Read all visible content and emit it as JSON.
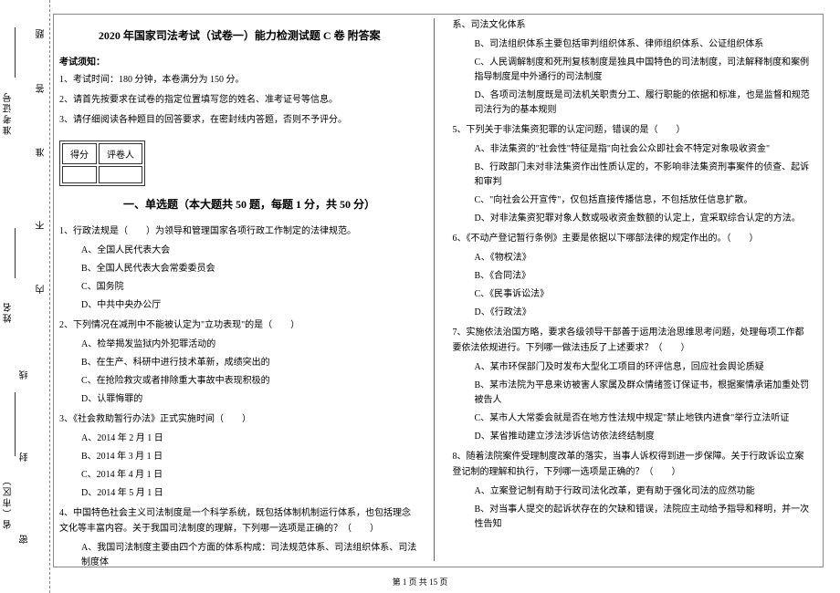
{
  "binding": {
    "province_label": "省（市区）",
    "name_label": "姓名",
    "ticket_label": "准考证号",
    "seal": "密",
    "seal2": "封",
    "seal3": "线",
    "seal4": "内",
    "seal5": "不",
    "seal6": "准",
    "seal7": "答",
    "seal8": "题"
  },
  "title": "2020 年国家司法考试（试卷一）能力检测试题 C 卷 附答案",
  "instructions_header": "考试须知：",
  "instructions": {
    "i1": "1、考试时间：180 分钟，本卷满分为 150 分。",
    "i2": "2、请首先按要求在试卷的指定位置填写您的姓名、准考证号等信息。",
    "i3": "3、请仔细阅读各种题目的回答要求，在密封线内答题，否则不予评分。"
  },
  "score_table": {
    "col1": "得分",
    "col2": "评卷人"
  },
  "section1_title": "一、单选题（本大题共 50 题，每题 1 分，共 50 分）",
  "q1": {
    "stem": "1、行政法规是（　　）为领导和管理国家各项行政工作制定的法律规范。",
    "a": "A、全国人民代表大会",
    "b": "B、全国人民代表大会常委委员会",
    "c": "C、国务院",
    "d": "D、中共中央办公厅"
  },
  "q2": {
    "stem": "2、下列情况在减刑中不能被认定为\"立功表现\"的是（　　）",
    "a": "A、检举揭发监狱内外犯罪活动的",
    "b": "B、在生产、科研中进行技术革新，成绩突出的",
    "c": "C、在抢险救灾或者排除重大事故中表现积极的",
    "d": "D、认罪悔罪的"
  },
  "q3": {
    "stem": "3、《社会救助暂行办法》正式实施时间（　　）",
    "a": "A、2014 年 2 月 1 日",
    "b": "B、2014 年 3 月 1 日",
    "c": "C、2014 年 4 月 1 日",
    "d": "D、2014 年 5 月 1 日"
  },
  "q4": {
    "stem": "4、中国特色社会主义司法制度是一个科学系统，既包括体制机制运行体系，也包括理念文化等丰富内容。关于我国司法制度的理解，下列哪一选项是正确的？（　　）",
    "a": "A、我国司法制度主要由四个方面的体系构成：司法规范体系、司法组织体系、司法制度体",
    "a_cont": "系、司法文化体系",
    "b": "B、司法组织体系主要包括审判组织体系、律师组织体系、公证组织体系",
    "c": "C、人民调解制度和死刑复核制度是独具中国特色的司法制度，司法解释制度和案例指导制度是中外通行的司法制度",
    "d": "D、各项司法制度既是司法机关职责分工、履行职能的依据和标准，也是监督和规范司法行为的基本规则"
  },
  "q5": {
    "stem": "5、下列关于非法集资犯罪的认定问题，错误的是（　　）",
    "a": "A、非法集资的\"社会性\"特征是指\"向社会公众即社会不特定对象吸收资金\"",
    "b": "B、行政部门未对非法集资作出性质认定的，不影响非法集资刑事案件的侦查、起诉和审判",
    "c": "C、\"向社会公开宣传\"，仅包括直接传播信息，不包括放任信息扩散。",
    "d": "D、对非法集资犯罪对象人数或吸收资金数额的认定上，宜采取综合认定的方法。"
  },
  "q6": {
    "stem": "6、《不动产登记暂行条例》主要是依据以下哪部法律的规定作出的。（　　）",
    "a": "A、《物权法》",
    "b": "B、《合同法》",
    "c": "C、《民事诉讼法》",
    "d": "D、《行政法》"
  },
  "q7": {
    "stem": "7、实施依法治国方略，要求各级领导干部善于运用法治思维思考问题，处理每项工作都要依法依规进行。下列哪一做法违反了上述要求？（　　）",
    "a": "A、某市环保部门及时发布大型化工项目的环评信息，回应社会舆论质疑",
    "b": "B、某市法院为平息来访被害人家属及群众情绪签订保证书，根据案情承诺加重处罚被告人",
    "c": "C、某市人大常委会就是否在地方性法规中规定\"禁止地铁内进食\"举行立法听证",
    "d": "D、某省推动建立涉法涉诉信访依法终结制度"
  },
  "q8": {
    "stem": "8、随着法院案件受理制度改革的落实，当事人诉权得到进一步保障。关于行政诉讼立案登记制的理解和执行，下列哪一选项是正确的？（　　）",
    "a": "A、立案登记制有助于行政司法化改革，更有助于强化司法的应然功能",
    "b": "B、对当事人提交的起诉状存在的欠缺和错误，法院应主动给予指导和释明，并一次性告知"
  },
  "footer": "第 1 页 共 15 页"
}
